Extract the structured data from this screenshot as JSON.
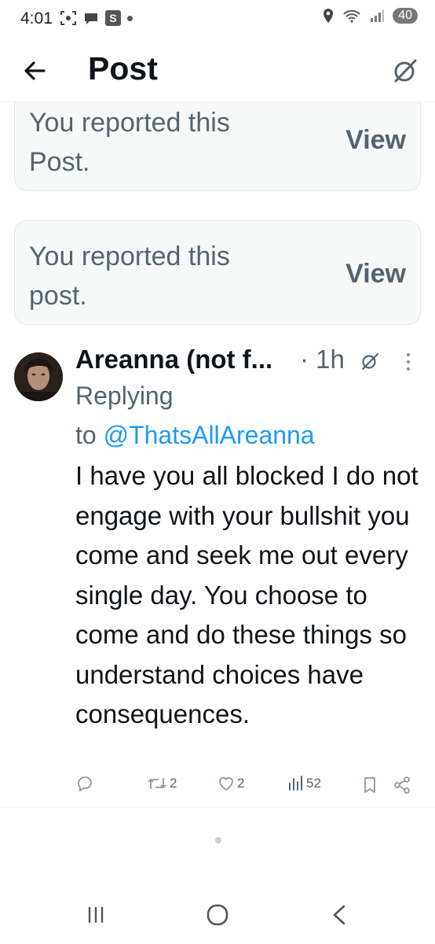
{
  "status_bar": {
    "time": "4:01",
    "battery": "40",
    "left_icons": [
      "screenshot-icon",
      "chat-bubble-icon",
      "s-app-icon",
      "dot-icon"
    ],
    "right_icons": [
      "location-icon",
      "wifi-icon",
      "signal-icon",
      "battery-icon"
    ]
  },
  "header": {
    "title": "Post",
    "back_icon": "back-arrow-icon",
    "right_icon": "grok-icon"
  },
  "report_cards": [
    {
      "text": "You reported this Post.",
      "action": "View"
    },
    {
      "text": "You reported this post.",
      "action": "View"
    }
  ],
  "tweet": {
    "author": "Areanna (not f...",
    "time": "· 1h",
    "replying_prefix": "Replying",
    "replying_to_word": "to",
    "replying_handle": "@ThatsAllAreanna",
    "body": "I have you all blocked I do not engage with your bullshit you come and seek me out every single day. You choose to come and do these things so understand choices have consequences.",
    "actions": {
      "reply_count": "",
      "retweet_count": "2",
      "like_count": "2",
      "view_count": "52"
    }
  },
  "nav": {
    "recents": "recents-icon",
    "home": "home-icon",
    "back": "back-icon"
  }
}
